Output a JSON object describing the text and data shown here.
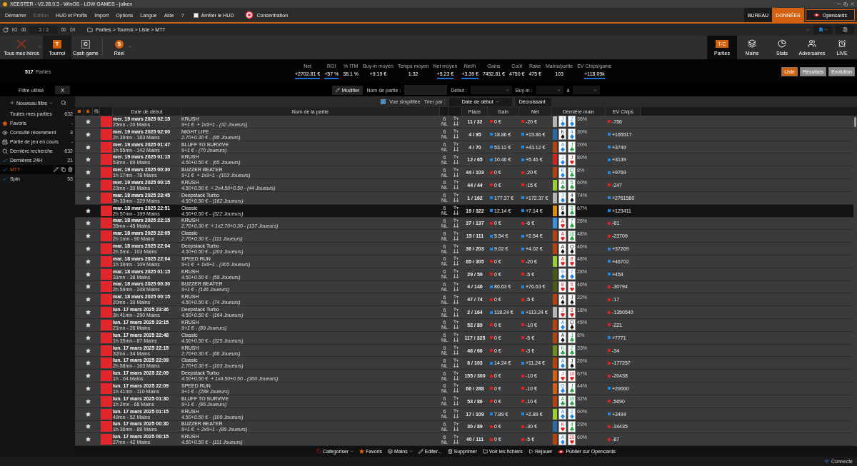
{
  "window": {
    "title": "XEESTER - V2.28.0.3 - WinOS - LOW GAMES - jolken"
  },
  "menu": [
    {
      "label": "Démarrer",
      "disabled": false
    },
    {
      "label": "Edition",
      "disabled": true
    },
    {
      "label": "HUD et Profils",
      "disabled": false
    },
    {
      "label": "Import",
      "disabled": false
    },
    {
      "label": "Options",
      "disabled": false
    },
    {
      "label": "Langue",
      "disabled": false
    },
    {
      "label": "Aide",
      "disabled": false
    },
    {
      "label": "?",
      "disabled": false
    }
  ],
  "hud_toggle": {
    "label": "Arrêter le HUD",
    "checked": false
  },
  "concentration": {
    "label": "Concentration"
  },
  "workspace_tabs": [
    {
      "label": "BUREAU",
      "selected": false
    },
    {
      "label": "DONNÉES",
      "selected": true
    }
  ],
  "opencards_button": {
    "label": "Opencards"
  },
  "navigation": {
    "page": "3 / 3",
    "breadcrumb": "Parties > Tournoi > Liste > MTT"
  },
  "modes": [
    {
      "label": "Tous mes héros",
      "kind": "heroes",
      "dropdown": true,
      "selected": false
    },
    {
      "label": "Tournoi",
      "kind": "letter",
      "symbol": "T",
      "dropdown": false,
      "selected": true
    },
    {
      "label": "Cash game",
      "kind": "letter",
      "symbol": "C",
      "dropdown": false,
      "selected": false
    },
    {
      "label": "Réel",
      "kind": "money",
      "symbol": "$",
      "dropdown": true,
      "selected": false
    }
  ],
  "views": [
    {
      "label": "Parties",
      "kind": "games",
      "badge": "T-C",
      "selected": true
    },
    {
      "label": "Mains",
      "kind": "hands",
      "selected": false
    },
    {
      "label": "Stats",
      "kind": "stats",
      "selected": false
    },
    {
      "label": "Adversaires",
      "kind": "opponents",
      "selected": false
    },
    {
      "label": "LIVE",
      "kind": "live",
      "selected": false
    }
  ],
  "summary": {
    "count": "517",
    "label": "Parties"
  },
  "stats": [
    {
      "label": "Net",
      "value": "+2702.81 €",
      "underlined": true
    },
    {
      "label": "ROI",
      "value": "+57 %",
      "underlined": true
    },
    {
      "label": "% ITM",
      "value": "38.1 %",
      "underlined": false
    },
    {
      "label": "Buy-in moyen",
      "value": "+9.19 €",
      "underlined": false
    },
    {
      "label": "Temps moyen",
      "value": "1:32",
      "underlined": false
    },
    {
      "label": "Net moyen",
      "value": "+5.23 €",
      "underlined": true
    },
    {
      "label": "Net/h",
      "value": "+3.39 €",
      "underlined": true
    },
    {
      "label": "Gains",
      "value": "7452.81 €",
      "underlined": false
    },
    {
      "label": "Coût",
      "value": "4750 €",
      "underlined": false
    },
    {
      "label": "Rake",
      "value": "475 €",
      "underlined": false
    },
    {
      "label": "Mains/partie",
      "value": "103",
      "underlined": false
    },
    {
      "label": "EV Chips/game",
      "value": "+118.09k",
      "underlined": true
    }
  ],
  "result_views": [
    {
      "label": "Liste",
      "selected": true
    },
    {
      "label": "Résultats",
      "selected": false
    },
    {
      "label": "Evolution",
      "selected": false
    }
  ],
  "sidebar": {
    "filter_title": "Filtre utilisé",
    "clear": "X",
    "new_filter": "Nouveau filtre",
    "items": [
      {
        "label": "Toutes mes parties",
        "count": "632",
        "kind": "plain",
        "selected": false
      },
      {
        "label": "Favoris",
        "count": "-",
        "kind": "favorites",
        "selected": false
      },
      {
        "label": "Consulté récemment",
        "count": "3",
        "kind": "recent",
        "selected": false
      },
      {
        "label": "Partie de jeu en cours",
        "count": "-",
        "kind": "running",
        "selected": false
      },
      {
        "label": "Dernière recherche",
        "count": "632",
        "kind": "search",
        "selected": false
      },
      {
        "label": "Dernières 24H",
        "count": "21",
        "kind": "custom",
        "selected": false
      },
      {
        "label": "MTT",
        "kind": "custom",
        "selected": true
      },
      {
        "label": "Spin",
        "count": "53",
        "kind": "custom",
        "selected": false
      }
    ]
  },
  "filters": {
    "edit": "Modifier",
    "name_label": "Nom de partie :",
    "start_label": "Début :",
    "buyin_label": "Buy-in :",
    "to_label": "à",
    "simplified": {
      "label": "Vue simplifiée",
      "checked": true
    },
    "sort_label": "Trier par :",
    "sort_field": "Date de début",
    "sort_order": "Décroissant"
  },
  "table": {
    "columns": [
      "Date de début",
      "Nom de la partie",
      "Place",
      "Gain",
      "Net",
      "Dernière main",
      "EV Chips"
    ],
    "rows": [
      {
        "date": "mer. 19 mars 2025 02:15",
        "info": "25mn - 20 Mains",
        "name": "KRUSH",
        "structure": "9+1 €  + 1x9+1 - (32 Joueurs)",
        "seats": "6",
        "game": "NL",
        "place": "11 / 32",
        "gain": {
          "text": "0 €",
          "color": "#e02020"
        },
        "net": {
          "text": "-20 €",
          "color": "#e02020"
        },
        "hand": {
          "color": "#b4b4b4"
        },
        "cards": [
          {
            "rank": "J",
            "kind": "diamond"
          },
          {
            "rank": "2",
            "kind": "diamond"
          }
        ],
        "equity": "36%",
        "ev": {
          "text": "-756",
          "color": "#e02020"
        },
        "selected": false
      },
      {
        "date": "mer. 19 mars 2025 02:00",
        "info": "2h 39mn - 183 Mains",
        "name": "NIGHT LIFE",
        "structure": "2.70+0.30 € - (95 Joueurs)",
        "seats": "6",
        "game": "NL",
        "place": "4 / 95",
        "gain": {
          "text": "18.86 €",
          "color": "#1e88e5"
        },
        "net": {
          "text": "+15.86 €",
          "color": "#1e88e5"
        },
        "hand": {
          "color": "#2c6aa8"
        },
        "cards": [
          {
            "rank": "K",
            "kind": "spade"
          },
          {
            "rank": "4",
            "kind": "diamond"
          }
        ],
        "equity": "30%",
        "ev": {
          "text": "+165517",
          "color": "#1e88e5"
        },
        "selected": false
      },
      {
        "date": "mer. 19 mars 2025 01:47",
        "info": "1h 55mn - 142 Mains",
        "name": "BLUFF TO SURVIVE",
        "structure": "9+1 € - (70 Joueurs)",
        "seats": "6",
        "game": "NL",
        "place": "4 / 70",
        "gain": {
          "text": "53.12 €",
          "color": "#1e88e5"
        },
        "net": {
          "text": "+43.12 €",
          "color": "#1e88e5"
        },
        "hand": {
          "color": "#b5420f"
        },
        "cards": [
          {
            "rank": "A",
            "kind": "diamond"
          },
          {
            "rank": "J",
            "kind": "club"
          }
        ],
        "equity": "20%",
        "ev": {
          "text": "+3749",
          "color": "#1e88e5"
        },
        "selected": false
      },
      {
        "date": "mer. 19 mars 2025 01:15",
        "info": "53mn - 69 Mains",
        "name": "KRUSH",
        "structure": "4.50+0.50 € - (65 Joueurs)",
        "seats": "6",
        "game": "NL",
        "place": "12 / 65",
        "gain": {
          "text": "10.46 €",
          "color": "#1e88e5"
        },
        "net": {
          "text": "+5.46 €",
          "color": "#1e88e5"
        },
        "hand": {
          "color": "#d42020"
        },
        "cards": [
          {
            "rank": "J",
            "kind": "diamond"
          },
          {
            "rank": "J",
            "kind": "heart"
          }
        ],
        "equity": "80%",
        "ev": {
          "text": "+3139",
          "color": "#1e88e5"
        },
        "selected": false
      },
      {
        "date": "mer. 19 mars 2025 00:30",
        "info": "1h 17mn - 78 Mains",
        "name": "BUZZER BEATER",
        "structure": "9+1 €  + 1x9+1 - (103 Joueurs)",
        "seats": "6",
        "game": "NL",
        "place": "44 / 103",
        "gain": {
          "text": "0 €",
          "color": "#e02020"
        },
        "net": {
          "text": "-20 €",
          "color": "#e02020"
        },
        "hand": {
          "color": "#b5420f"
        },
        "cards": [
          {
            "rank": "K",
            "kind": "diamond"
          },
          {
            "rank": "Q",
            "kind": "club"
          }
        ],
        "equity": "8%",
        "ev": {
          "text": "+9769",
          "color": "#1e88e5"
        },
        "selected": false
      },
      {
        "date": "mer. 19 mars 2025 00:15",
        "info": "23mn - 30 Mains",
        "name": "KRUSH",
        "structure": "4.50+0.50 €  + 2x4.50+0.50 - (44 Joueurs)",
        "seats": "6",
        "game": "NL",
        "place": "44 / 44",
        "gain": {
          "text": "0 €",
          "color": "#e02020"
        },
        "net": {
          "text": "-15 €",
          "color": "#e02020"
        },
        "hand": {
          "color": "#9acd32"
        },
        "cards": [
          {
            "rank": "A",
            "kind": "club"
          },
          {
            "rank": "5",
            "kind": "club"
          }
        ],
        "equity": "60%",
        "ev": {
          "text": "-247",
          "color": "#e02020"
        },
        "selected": false
      },
      {
        "date": "mar. 18 mars 2025 23:45",
        "info": "3h 33mn - 329 Mains",
        "name": "Deepstack Turbo",
        "structure": "4.50+0.50 € - (162 Joueurs)",
        "seats": "6",
        "game": "NL",
        "place": "1 / 162",
        "gain": {
          "text": "177.37 €",
          "color": "#1e88e5"
        },
        "net": {
          "text": "+172.37 €",
          "color": "#1e88e5"
        },
        "hand": {
          "color": "#b4b4b4"
        },
        "cards": [
          {
            "rank": "J",
            "kind": "diamond"
          },
          {
            "rank": "4",
            "kind": "spade"
          }
        ],
        "equity": "74%",
        "ev": {
          "text": "+2761580",
          "color": "#1e88e5"
        },
        "selected": false
      },
      {
        "date": "mar. 18 mars 2025 22:51",
        "info": "2h 57mn - 199 Mains",
        "name": "Classic",
        "structure": "4.50+0.50 € - (322 Joueurs)",
        "seats": "6",
        "game": "NL",
        "place": "19 / 322",
        "gain": {
          "text": "12.14 €",
          "color": "#1e88e5"
        },
        "net": {
          "text": "+7.14 €",
          "color": "#1e88e5"
        },
        "hand": {
          "color": "#e08a10"
        },
        "cards": [
          {
            "rank": "8",
            "kind": "spade"
          },
          {
            "rank": "8",
            "kind": "club"
          }
        ],
        "equity": "67%",
        "ev": {
          "text": "+123411",
          "color": "#1e88e5"
        },
        "selected": true
      },
      {
        "date": "mar. 18 mars 2025 22:15",
        "info": "35mn - 45 Mains",
        "name": "KRUSH",
        "structure": "2.70+0.30 €  + 1x2.70+0.30 - (137 Joueurs)",
        "seats": "6",
        "game": "NL",
        "place": "37 / 137",
        "gain": {
          "text": "0 €",
          "color": "#e02020"
        },
        "net": {
          "text": "-6 €",
          "color": "#e02020"
        },
        "hand": {
          "color": "#3a90e0"
        },
        "cards": [
          {
            "rank": "A",
            "kind": "heart"
          },
          {
            "rank": "7",
            "kind": "club"
          }
        ],
        "equity": "26%",
        "ev": {
          "text": "-81",
          "color": "#e02020"
        },
        "selected": false
      },
      {
        "date": "mar. 18 mars 2025 22:05",
        "info": "2h 1mn - 90 Mains",
        "name": "Classic",
        "structure": "2.70+0.30 € - (111 Joueurs)",
        "seats": "8",
        "game": "NL",
        "place": "15 / 111",
        "gain": {
          "text": "5.54 €",
          "color": "#1e88e5"
        },
        "net": {
          "text": "+2.54 €",
          "color": "#1e88e5"
        },
        "hand": {
          "color": "#b5420f"
        },
        "cards": [
          {
            "rank": "A",
            "kind": "heart"
          },
          {
            "rank": "10",
            "kind": "club"
          }
        ],
        "equity": "48%",
        "ev": {
          "text": "-23709",
          "color": "#e02020"
        },
        "selected": false
      },
      {
        "date": "mar. 18 mars 2025 22:04",
        "info": "2h 5mn - 103 Mains",
        "name": "Deepstack Turbo",
        "structure": "4.50+0.50 € - (203 Joueurs)",
        "seats": "6",
        "game": "NL",
        "place": "36 / 203",
        "gain": {
          "text": "9.02 €",
          "color": "#1e88e5"
        },
        "net": {
          "text": "+4.02 €",
          "color": "#1e88e5"
        },
        "hand": {
          "color": "#b5420f"
        },
        "cards": [
          {
            "rank": "A",
            "kind": "spade"
          },
          {
            "rank": "Q",
            "kind": "spade"
          }
        ],
        "equity": "46%",
        "ev": {
          "text": "+37269",
          "color": "#1e88e5"
        },
        "selected": false
      },
      {
        "date": "mar. 18 mars 2025 22:04",
        "info": "1h 39mn - 109 Mains",
        "name": "SPEED RUN",
        "structure": "9+1 €  + 1x9+1 - (305 Joueurs)",
        "seats": "6",
        "game": "NL",
        "place": "85 / 305",
        "gain": {
          "text": "0 €",
          "color": "#e02020"
        },
        "net": {
          "text": "-20 €",
          "color": "#e02020"
        },
        "hand": {
          "color": "#9acd32"
        },
        "cards": [
          {
            "rank": "A",
            "kind": "heart"
          },
          {
            "rank": "8",
            "kind": "heart"
          }
        ],
        "equity": "48%",
        "ev": {
          "text": "+46702",
          "color": "#1e88e5"
        },
        "selected": false
      },
      {
        "date": "mar. 18 mars 2025 01:15",
        "info": "31mn - 38 Mains",
        "name": "KRUSH",
        "structure": "4.50+0.50 € - (59 Joueurs)",
        "seats": "6",
        "game": "NL",
        "place": "29 / 59",
        "gain": {
          "text": "0 €",
          "color": "#e02020"
        },
        "net": {
          "text": "-5 €",
          "color": "#e02020"
        },
        "hand": {
          "color": "#485c18"
        },
        "cards": [
          {
            "rank": "9",
            "kind": "diamond"
          },
          {
            "rank": "7",
            "kind": "diamond"
          }
        ],
        "equity": "28%",
        "ev": {
          "text": "+454",
          "color": "#1e88e5"
        },
        "selected": false
      },
      {
        "date": "mar. 18 mars 2025 00:30",
        "info": "2h 59mn - 248 Mains",
        "name": "BUZZER BEATER",
        "structure": "9+1 € - (146 Joueurs)",
        "seats": "6",
        "game": "NL",
        "place": "4 / 146",
        "gain": {
          "text": "86.63 €",
          "color": "#1e88e5"
        },
        "net": {
          "text": "+76.63 €",
          "color": "#1e88e5"
        },
        "hand": {
          "color": "#485c18"
        },
        "cards": [
          {
            "rank": "8",
            "kind": "heart"
          },
          {
            "rank": "5",
            "kind": "heart"
          }
        ],
        "equity": "46%",
        "ev": {
          "text": "-30794",
          "color": "#e02020"
        },
        "selected": false
      },
      {
        "date": "mar. 18 mars 2025 00:15",
        "info": "20mn - 30 Mains",
        "name": "KRUSH",
        "structure": "4.50+0.50 € - (74 Joueurs)",
        "seats": "6",
        "game": "NL",
        "place": "47 / 74",
        "gain": {
          "text": "0 €",
          "color": "#e02020"
        },
        "net": {
          "text": "-5 €",
          "color": "#e02020"
        },
        "hand": {
          "color": "#b5420f"
        },
        "cards": [
          {
            "rank": "A",
            "kind": "spade"
          },
          {
            "rank": "J",
            "kind": "spade"
          }
        ],
        "equity": "22%",
        "ev": {
          "text": "-17",
          "color": "#e02020"
        },
        "selected": false
      },
      {
        "date": "lun. 17 mars 2025 23:36",
        "info": "3h 41mn - 290 Mains",
        "name": "Deepstack Turbo",
        "structure": "4.50+0.50 € - (164 Joueurs)",
        "seats": "6",
        "game": "NL",
        "place": "2 / 164",
        "gain": {
          "text": "118.24 €",
          "color": "#1e88e5"
        },
        "net": {
          "text": "+113.24 €",
          "color": "#1e88e5"
        },
        "hand": {
          "color": "#b4b4b4"
        },
        "cards": [
          {
            "rank": "J",
            "kind": "heart"
          },
          {
            "rank": "8",
            "kind": "heart"
          }
        ],
        "equity": "18%",
        "ev": {
          "text": "-1350540",
          "color": "#e02020"
        },
        "selected": false
      },
      {
        "date": "lun. 17 mars 2025 23:15",
        "info": "21mn - 26 Mains",
        "name": "KRUSH",
        "structure": "9+1 € - (89 Joueurs)",
        "seats": "6",
        "game": "NL",
        "place": "52 / 89",
        "gain": {
          "text": "0 €",
          "color": "#e02020"
        },
        "net": {
          "text": "-10 €",
          "color": "#e02020"
        },
        "hand": {
          "color": "#b5420f"
        },
        "cards": [
          {
            "rank": "A",
            "kind": "diamond"
          },
          {
            "rank": "Q",
            "kind": "spade"
          }
        ],
        "equity": "45%",
        "ev": {
          "text": "-221",
          "color": "#e02020"
        },
        "selected": false
      },
      {
        "date": "lun. 17 mars 2025 22:48",
        "info": "1h 35mn - 87 Mains",
        "name": "Classic",
        "structure": "4.50+0.50 € - (325 Joueurs)",
        "seats": "6",
        "game": "NL",
        "place": "117 / 325",
        "gain": {
          "text": "0 €",
          "color": "#e02020"
        },
        "net": {
          "text": "-5 €",
          "color": "#e02020"
        },
        "hand": {
          "color": "#b5420f"
        },
        "cards": [
          {
            "rank": "A",
            "kind": "spade"
          },
          {
            "rank": "J",
            "kind": "club"
          }
        ],
        "equity": "8%",
        "ev": {
          "text": "+7771",
          "color": "#1e88e5"
        },
        "selected": false
      },
      {
        "date": "lun. 17 mars 2025 22:15",
        "info": "32mn - 34 Mains",
        "name": "KRUSH",
        "structure": "2.70+0.30 € - (66 Joueurs)",
        "seats": "6",
        "game": "NL",
        "place": "46 / 66",
        "gain": {
          "text": "0 €",
          "color": "#e02020"
        },
        "net": {
          "text": "-3 €",
          "color": "#e02020"
        },
        "hand": {
          "color": "#6b8e23"
        },
        "cards": [
          {
            "rank": "K",
            "kind": "club"
          },
          {
            "rank": "2",
            "kind": "club"
          }
        ],
        "equity": "33%",
        "ev": {
          "text": "-34",
          "color": "#e02020"
        },
        "selected": false
      },
      {
        "date": "lun. 17 mars 2025 22:09",
        "info": "2h 58mn - 163 Mains",
        "name": "Classic",
        "structure": "2.70+0.30 € - (103 Joueurs)",
        "seats": "8",
        "game": "NL",
        "place": "6 / 103",
        "gain": {
          "text": "14.24 €",
          "color": "#1e88e5"
        },
        "net": {
          "text": "+11.24 €",
          "color": "#1e88e5"
        },
        "hand": {
          "color": "#b5420f"
        },
        "cards": [
          {
            "rank": "A",
            "kind": "diamond"
          },
          {
            "rank": "J",
            "kind": "spade"
          }
        ],
        "equity": "26%",
        "ev": {
          "text": "-177257",
          "color": "#e02020"
        },
        "selected": false
      },
      {
        "date": "lun. 17 mars 2025 22:09",
        "info": "1h - 64 Mains",
        "name": "Deepstack Turbo",
        "structure": "4.50+0.50 €  + 1x4.50+0.50 - (300 Joueurs)",
        "seats": "6",
        "game": "NL",
        "place": "155 / 300",
        "gain": {
          "text": "0 €",
          "color": "#e02020"
        },
        "net": {
          "text": "-10 €",
          "color": "#e02020"
        },
        "hand": {
          "color": "#d2600f"
        },
        "cards": [
          {
            "rank": "J",
            "kind": "heart"
          },
          {
            "rank": "10",
            "kind": "heart"
          }
        ],
        "equity": "67%",
        "ev": {
          "text": "-20438",
          "color": "#e02020"
        },
        "selected": false
      },
      {
        "date": "lun. 17 mars 2025 22:09",
        "info": "1h 41mn - 110 Mains",
        "name": "SPEED RUN",
        "structure": "9+1 € - (288 Joueurs)",
        "seats": "6",
        "game": "NL",
        "place": "66 / 288",
        "gain": {
          "text": "0 €",
          "color": "#e02020"
        },
        "net": {
          "text": "-10 €",
          "color": "#e02020"
        },
        "hand": {
          "color": "#d2600f"
        },
        "cards": [
          {
            "rank": "Q",
            "kind": "diamond"
          },
          {
            "rank": "J",
            "kind": "club"
          }
        ],
        "equity": "44%",
        "ev": {
          "text": "+29060",
          "color": "#1e88e5"
        },
        "selected": false
      },
      {
        "date": "lun. 17 mars 2025 01:30",
        "info": "1h 2mn - 68 Mains",
        "name": "BLUFF TO SURVIVE",
        "structure": "9+1 € - (86 Joueurs)",
        "seats": "6",
        "game": "NL",
        "place": "53 / 86",
        "gain": {
          "text": "0 €",
          "color": "#e02020"
        },
        "net": {
          "text": "-10 €",
          "color": "#e02020"
        },
        "hand": {
          "color": "#b5420f"
        },
        "cards": [
          {
            "rank": "A",
            "kind": "club"
          },
          {
            "rank": "10",
            "kind": "club"
          }
        ],
        "equity": "32%",
        "ev": {
          "text": "-5690",
          "color": "#e02020"
        },
        "selected": false
      },
      {
        "date": "lun. 17 mars 2025 01:15",
        "info": "49mn - 52 Mains",
        "name": "KRUSH",
        "structure": "4.50+0.50 € - (109 Joueurs)",
        "seats": "6",
        "game": "NL",
        "place": "17 / 109",
        "gain": {
          "text": "7.89 €",
          "color": "#1e88e5"
        },
        "net": {
          "text": "+2.89 €",
          "color": "#1e88e5"
        },
        "hand": {
          "color": "#9acd32"
        },
        "cards": [
          {
            "rank": "A",
            "kind": "diamond"
          },
          {
            "rank": "2",
            "kind": "diamond"
          }
        ],
        "equity": "60%",
        "ev": {
          "text": "+3494",
          "color": "#1e88e5"
        },
        "selected": false
      },
      {
        "date": "lun. 17 mars 2025 00:30",
        "info": "1h 36mn - 88 Mains",
        "name": "BUZZER BEATER",
        "structure": "9+1 €  + 2x9+1 - (89 Joueurs)",
        "seats": "6",
        "game": "NL",
        "place": "30 / 89",
        "gain": {
          "text": "0 €",
          "color": "#e02020"
        },
        "net": {
          "text": "-30 €",
          "color": "#e02020"
        },
        "hand": {
          "color": "#2c6aa8"
        },
        "cards": [
          {
            "rank": "K",
            "kind": "heart"
          },
          {
            "rank": "4",
            "kind": "club"
          }
        ],
        "equity": "23%",
        "ev": {
          "text": "-34435",
          "color": "#e02020"
        },
        "selected": false
      },
      {
        "date": "lun. 17 mars 2025 00:15",
        "info": "27mn - 42 Mains",
        "name": "KRUSH",
        "structure": "4.50+0.50 € - (111 Joueurs)",
        "seats": "6",
        "game": "NL",
        "place": "40 / 111",
        "gain": {
          "text": "0 €",
          "color": "#e02020"
        },
        "net": {
          "text": "-5 €",
          "color": "#e02020"
        },
        "hand": {
          "color": "#b5420f"
        },
        "cards": [
          {
            "rank": "A",
            "kind": "diamond"
          },
          {
            "rank": "10",
            "kind": "heart"
          }
        ],
        "equity": "60%",
        "ev": {
          "text": "-87",
          "color": "#e02020"
        },
        "selected": false
      }
    ]
  },
  "toolbar": [
    {
      "label": "Catégoriser",
      "kind": "categorize",
      "dropdown": true
    },
    {
      "label": "Favoris",
      "kind": "favorite",
      "dropdown": false
    },
    {
      "label": "Mains",
      "kind": "hands",
      "dropdown": true
    },
    {
      "label": "Editer...",
      "kind": "edit",
      "dropdown": false
    },
    {
      "label": "Supprimer",
      "kind": "delete",
      "dropdown": false
    },
    {
      "label": "Voir les fichiers",
      "kind": "files",
      "dropdown": false
    },
    {
      "label": "Rejouer",
      "kind": "replay",
      "dropdown": false
    },
    {
      "label": "Publier sur Opencards",
      "kind": "publish",
      "dropdown": false
    }
  ],
  "status": {
    "label": "Connecté"
  }
}
